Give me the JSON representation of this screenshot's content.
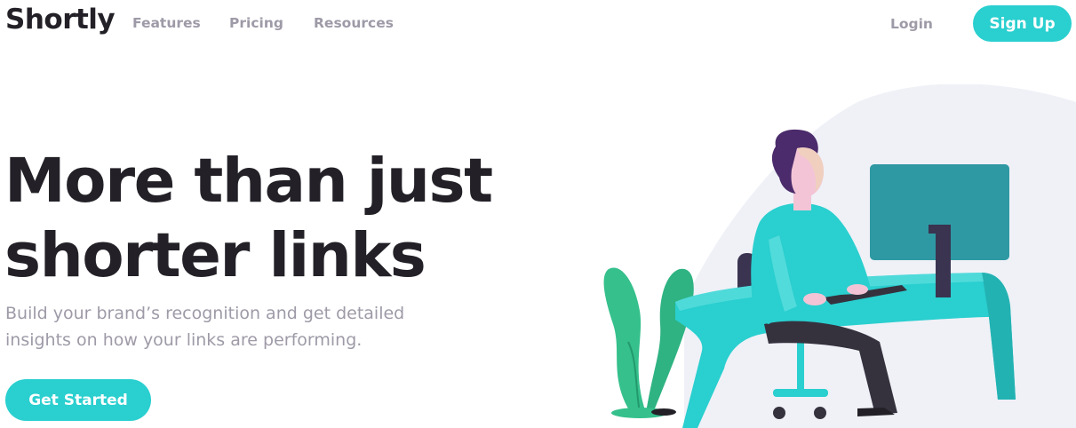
{
  "header": {
    "logo": "Shortly",
    "nav": {
      "features": "Features",
      "pricing": "Pricing",
      "resources": "Resources"
    },
    "login": "Login",
    "signup": "Sign Up"
  },
  "hero": {
    "headline_line1": "More than just",
    "headline_line2": "shorter links",
    "subtext": "Build your brand’s recognition and get detailed insights on how your links are performing.",
    "cta": "Get Started"
  },
  "illustration": {
    "icon": "person-working-illustration",
    "colors": {
      "cyan": "#2acfcf",
      "dark": "#35323e",
      "plant": "#35c08c",
      "background_blob": "#eff1f7"
    }
  },
  "colors": {
    "accent": "#2acfcf",
    "heading": "#232127",
    "muted": "#9e9aa7"
  }
}
